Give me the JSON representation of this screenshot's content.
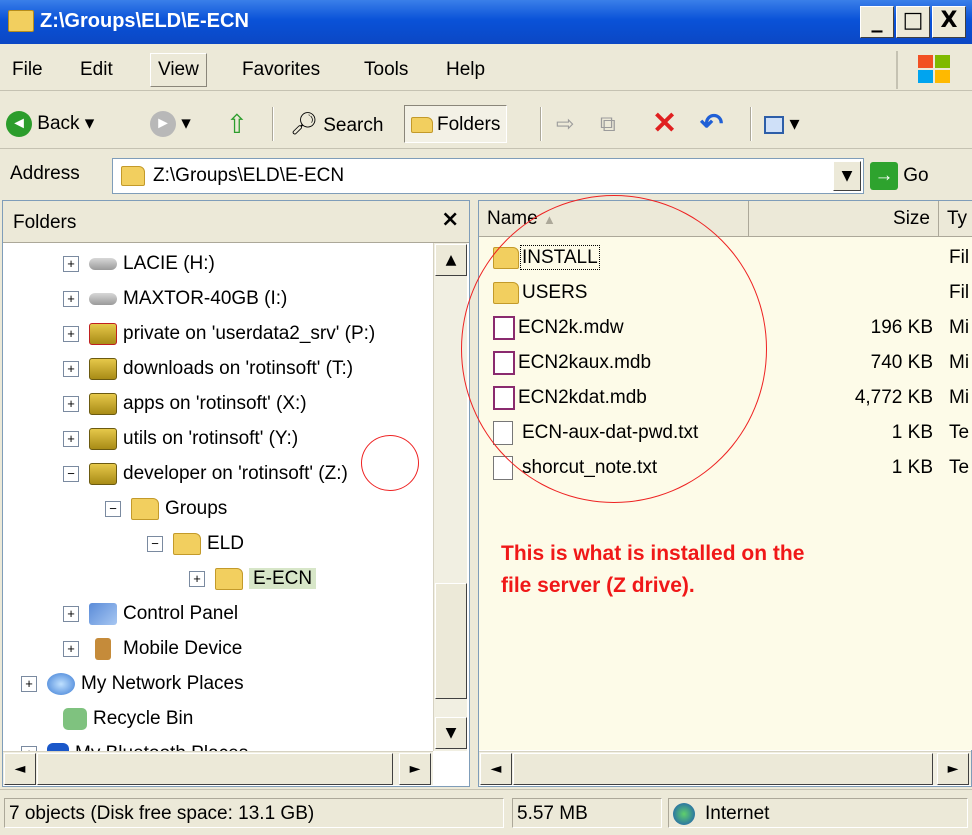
{
  "window": {
    "title": "Z:\\Groups\\ELD\\E-ECN",
    "min": "_",
    "max": "□",
    "close": "X"
  },
  "menu": [
    "File",
    "Edit",
    "View",
    "Favorites",
    "Tools",
    "Help"
  ],
  "toolbar": {
    "back": "Back",
    "search": "Search",
    "folders": "Folders"
  },
  "address": {
    "label": "Address",
    "value": "Z:\\Groups\\ELD\\E-ECN",
    "go": "Go"
  },
  "folders_pane": {
    "title": "Folders",
    "close": "×",
    "items": [
      {
        "label": "LACIE (H:)",
        "expander": "+",
        "icon": "drive-icon"
      },
      {
        "label": "MAXTOR-40GB (I:)",
        "expander": "+",
        "icon": "drive-icon"
      },
      {
        "label": "private on 'userdata2_srv' (P:)",
        "expander": "+",
        "icon": "network-drive-disconnected-icon"
      },
      {
        "label": "downloads on 'rotinsoft' (T:)",
        "expander": "+",
        "icon": "network-drive-icon"
      },
      {
        "label": "apps on 'rotinsoft' (X:)",
        "expander": "+",
        "icon": "network-drive-icon"
      },
      {
        "label": "utils on 'rotinsoft' (Y:)",
        "expander": "+",
        "icon": "network-drive-icon"
      },
      {
        "label": "developer on 'rotinsoft' (Z:)",
        "expander": "−",
        "icon": "network-drive-icon"
      },
      {
        "label": "Groups",
        "expander": "−",
        "icon": "folder-icon"
      },
      {
        "label": "ELD",
        "expander": "−",
        "icon": "folder-icon"
      },
      {
        "label": "E-ECN",
        "expander": "+",
        "icon": "folder-icon"
      },
      {
        "label": "Control Panel",
        "expander": "+",
        "icon": "control-panel-icon"
      },
      {
        "label": "Mobile Device",
        "expander": "+",
        "icon": "mobile-device-icon"
      },
      {
        "label": "My Network Places",
        "expander": "+",
        "icon": "network-places-icon"
      },
      {
        "label": "Recycle Bin",
        "expander": "",
        "icon": "recycle-bin-icon"
      },
      {
        "label": "My Bluetooth Places",
        "expander": "+",
        "icon": "bluetooth-icon"
      }
    ]
  },
  "file_list": {
    "columns": [
      "Name",
      "Size",
      "Ty"
    ],
    "rows": [
      {
        "name": "INSTALL",
        "size": "",
        "type": "Fil",
        "icon": "folder-icon"
      },
      {
        "name": "USERS",
        "size": "",
        "type": "Fil",
        "icon": "folder-icon"
      },
      {
        "name": "ECN2k.mdw",
        "size": "196 KB",
        "type": "Mi",
        "icon": "access-db-icon"
      },
      {
        "name": "ECN2kaux.mdb",
        "size": "740 KB",
        "type": "Mi",
        "icon": "access-db-icon"
      },
      {
        "name": "ECN2kdat.mdb",
        "size": "4,772 KB",
        "type": "Mi",
        "icon": "access-db-icon"
      },
      {
        "name": "ECN-aux-dat-pwd.txt",
        "size": "1 KB",
        "type": "Te",
        "icon": "text-file-icon"
      },
      {
        "name": "shorcut_note.txt",
        "size": "1 KB",
        "type": "Te",
        "icon": "text-file-icon"
      }
    ],
    "annotation": [
      "This is what is installed on the",
      "file server (Z drive)."
    ]
  },
  "status": {
    "objects": "7 objects (Disk free space: 13.1 GB)",
    "size": "5.57 MB",
    "zone": "Internet"
  },
  "colors": {
    "annotation": "#f01818",
    "titlebar": "#0a52d8"
  }
}
